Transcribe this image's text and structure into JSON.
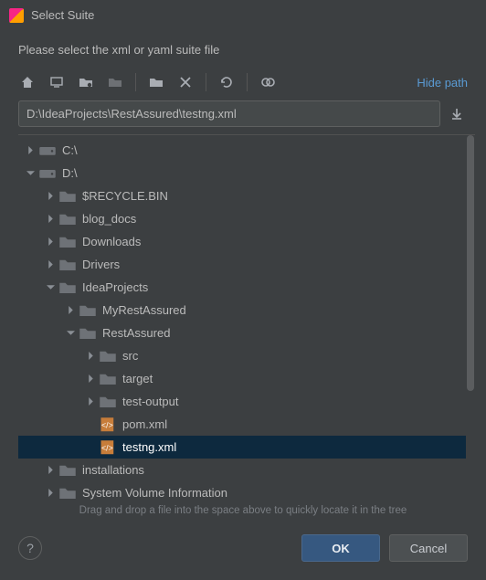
{
  "window": {
    "title": "Select Suite",
    "instruction": "Please select the xml or yaml suite file"
  },
  "toolbar": {
    "hide_path": "Hide path"
  },
  "path": {
    "value": "D:\\IdeaProjects\\RestAssured\\testng.xml"
  },
  "tree": [
    {
      "depth": 0,
      "arrow": "closed",
      "iconType": "drive",
      "label": "C:\\",
      "name": "drive-c"
    },
    {
      "depth": 0,
      "arrow": "open",
      "iconType": "drive",
      "label": "D:\\",
      "name": "drive-d"
    },
    {
      "depth": 1,
      "arrow": "closed",
      "iconType": "folder",
      "label": "$RECYCLE.BIN",
      "name": "folder-recyclebin"
    },
    {
      "depth": 1,
      "arrow": "closed",
      "iconType": "folder",
      "label": "blog_docs",
      "name": "folder-blog-docs"
    },
    {
      "depth": 1,
      "arrow": "closed",
      "iconType": "folder",
      "label": "Downloads",
      "name": "folder-downloads"
    },
    {
      "depth": 1,
      "arrow": "closed",
      "iconType": "folder",
      "label": "Drivers",
      "name": "folder-drivers"
    },
    {
      "depth": 1,
      "arrow": "open",
      "iconType": "folder",
      "label": "IdeaProjects",
      "name": "folder-ideaprojects"
    },
    {
      "depth": 2,
      "arrow": "closed",
      "iconType": "folder",
      "label": "MyRestAssured",
      "name": "folder-myrestassured"
    },
    {
      "depth": 2,
      "arrow": "open",
      "iconType": "folder",
      "label": "RestAssured",
      "name": "folder-restassured"
    },
    {
      "depth": 3,
      "arrow": "closed",
      "iconType": "folder",
      "label": "src",
      "name": "folder-src"
    },
    {
      "depth": 3,
      "arrow": "closed",
      "iconType": "folder",
      "label": "target",
      "name": "folder-target"
    },
    {
      "depth": 3,
      "arrow": "closed",
      "iconType": "folder",
      "label": "test-output",
      "name": "folder-test-output"
    },
    {
      "depth": 3,
      "arrow": "none",
      "iconType": "xml",
      "label": "pom.xml",
      "name": "file-pom-xml"
    },
    {
      "depth": 3,
      "arrow": "none",
      "iconType": "xml",
      "label": "testng.xml",
      "name": "file-testng-xml",
      "selected": true
    },
    {
      "depth": 1,
      "arrow": "closed",
      "iconType": "folder",
      "label": "installations",
      "name": "folder-installations"
    },
    {
      "depth": 1,
      "arrow": "closed",
      "iconType": "folder",
      "label": "System Volume Information",
      "name": "folder-sysvolinfo"
    }
  ],
  "hint": "Drag and drop a file into the space above to quickly locate it in the tree",
  "buttons": {
    "ok": "OK",
    "cancel": "Cancel",
    "help": "?"
  }
}
